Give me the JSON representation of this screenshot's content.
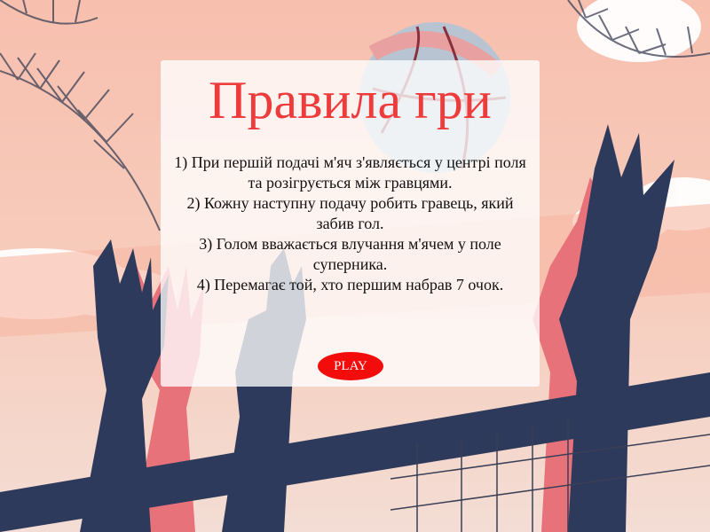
{
  "rules_screen": {
    "title": "Правила гри",
    "rules": [
      "1) При першій подачі м'яч з'являється у центрі поля та розігрується між гравцями.",
      "2) Кожну наступну подачу робить гравець, який забив гол.",
      "3) Голом вважається влучання м'ячем у поле суперника.",
      "4) Перемагає той, хто першим набрав 7 очок."
    ],
    "play_button_label": "PLAY"
  },
  "colors": {
    "title": "#ee3b3b",
    "play_button": "#f20c0c",
    "background_top": "#f6c3b3",
    "background_bottom": "#f4ddd2",
    "silhouette": "#2e3a5c",
    "silhouette_shadow": "#e8727a"
  },
  "background": {
    "scene": "volleyball players at net with ball, palm leaves"
  }
}
